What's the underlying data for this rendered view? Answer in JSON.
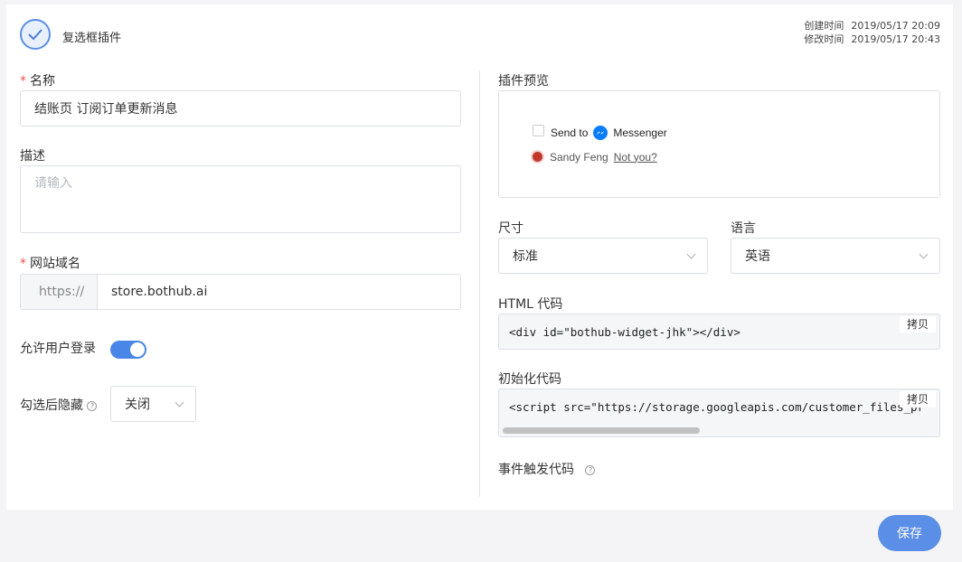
{
  "header": {
    "title": "复选框插件",
    "created_label": "创建时间",
    "created_value": "2019/05/17 20:09",
    "modified_label": "修改时间",
    "modified_value": "2019/05/17 20:43"
  },
  "form": {
    "name_label": "名称",
    "name_value": "结账页 订阅订单更新消息",
    "desc_label": "描述",
    "desc_placeholder": "请输入",
    "domain_label": "网站域名",
    "domain_prefix": "https://",
    "domain_value": "store.bothub.ai",
    "allow_login_label": "允许用户登录",
    "allow_login_on": true,
    "hide_after_label": "勾选后隐藏",
    "hide_after_value": "关闭"
  },
  "preview": {
    "label": "插件预览",
    "send_to": "Send to",
    "messenger": "Messenger",
    "user_name": "Sandy Feng",
    "not_you": "Not you?"
  },
  "settings": {
    "size_label": "尺寸",
    "size_value": "标准",
    "lang_label": "语言",
    "lang_value": "英语"
  },
  "code": {
    "html_label": "HTML 代码",
    "html_value": "<div id=\"bothub-widget-jhk\"></div>",
    "init_label": "初始化代码",
    "init_value": "<script src=\"https://storage.googleapis.com/customer_files_pr",
    "copy_label": "拷贝",
    "event_label": "事件触发代码"
  },
  "actions": {
    "save_label": "保存"
  },
  "colors": {
    "accent": "#5b8ee6",
    "toggle": "#4a86e8",
    "required": "#ee5555",
    "messenger": "#0a7cff"
  }
}
